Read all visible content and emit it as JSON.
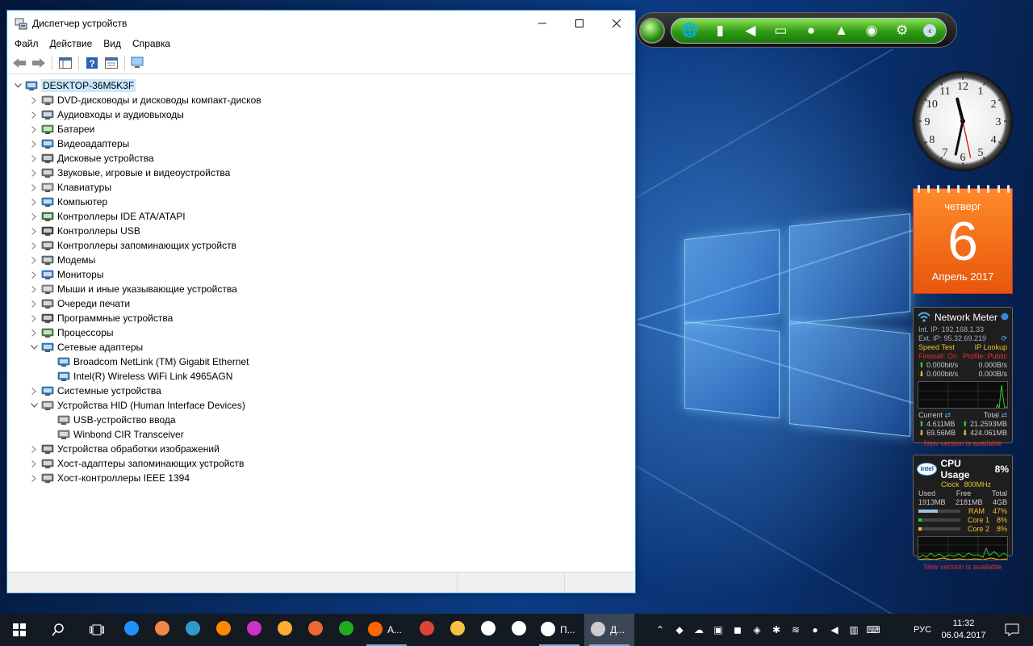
{
  "window": {
    "title": "Диспетчер устройств",
    "menu": [
      "Файл",
      "Действие",
      "Вид",
      "Справка"
    ],
    "tree": {
      "root": "DESKTOP-36M5K3F",
      "categories": [
        {
          "label": "DVD-дисководы и дисководы компакт-дисков",
          "icon": "dvd-drive-icon",
          "expanded": false
        },
        {
          "label": "Аудиовходы и аудиовыходы",
          "icon": "audio-io-icon",
          "expanded": false
        },
        {
          "label": "Батареи",
          "icon": "battery-icon",
          "expanded": false
        },
        {
          "label": "Видеоадаптеры",
          "icon": "display-adapter-icon",
          "expanded": false
        },
        {
          "label": "Дисковые устройства",
          "icon": "disk-drive-icon",
          "expanded": false
        },
        {
          "label": "Звуковые, игровые и видеоустройства",
          "icon": "sound-device-icon",
          "expanded": false
        },
        {
          "label": "Клавиатуры",
          "icon": "keyboard-icon",
          "expanded": false
        },
        {
          "label": "Компьютер",
          "icon": "computer-icon",
          "expanded": false
        },
        {
          "label": "Контроллеры IDE ATA/ATAPI",
          "icon": "ide-controller-icon",
          "expanded": false
        },
        {
          "label": "Контроллеры USB",
          "icon": "usb-icon",
          "expanded": false
        },
        {
          "label": "Контроллеры запоминающих устройств",
          "icon": "storage-controller-icon",
          "expanded": false
        },
        {
          "label": "Модемы",
          "icon": "modem-icon",
          "expanded": false
        },
        {
          "label": "Мониторы",
          "icon": "monitor-icon",
          "expanded": false
        },
        {
          "label": "Мыши и иные указывающие устройства",
          "icon": "mouse-icon",
          "expanded": false
        },
        {
          "label": "Очереди печати",
          "icon": "print-queue-icon",
          "expanded": false
        },
        {
          "label": "Программные устройства",
          "icon": "software-device-icon",
          "expanded": false
        },
        {
          "label": "Процессоры",
          "icon": "processor-icon",
          "expanded": false
        },
        {
          "label": "Сетевые адаптеры",
          "icon": "network-adapter-icon",
          "expanded": true,
          "children": [
            "Broadcom NetLink (TM) Gigabit Ethernet",
            "Intel(R) Wireless WiFi Link 4965AGN"
          ]
        },
        {
          "label": "Системные устройства",
          "icon": "system-device-icon",
          "expanded": false
        },
        {
          "label": "Устройства HID (Human Interface Devices)",
          "icon": "hid-icon",
          "expanded": true,
          "children": [
            "USB-устройство ввода",
            "Winbond CIR Transceiver"
          ]
        },
        {
          "label": "Устройства обработки изображений",
          "icon": "imaging-device-icon",
          "expanded": false
        },
        {
          "label": "Хост-адаптеры запоминающих устройств",
          "icon": "storage-host-icon",
          "expanded": false
        },
        {
          "label": "Хост-контроллеры IEEE 1394",
          "icon": "ieee1394-icon",
          "expanded": false
        }
      ]
    }
  },
  "gadgets": {
    "toolbar_icons": [
      "globe-icon",
      "battery-icon",
      "volume-icon",
      "radio-icon",
      "bulb-icon",
      "lock-icon",
      "globe-update-icon",
      "gear-icon",
      "collapse-arrow-icon"
    ],
    "clock": {
      "hour": 11,
      "minute": 32,
      "second": 28
    },
    "calendar": {
      "weekday": "четверг",
      "day": "6",
      "month": "Апрель 2017"
    },
    "network_meter": {
      "title": "Network Meter",
      "int_ip": "Int. IP: 192.168.1.33",
      "ext_ip": "Ext. IP: 95.32.69.219",
      "speed_test": "Speed Test",
      "ip_lookup": "IP Lookup",
      "firewall": "Firewall: On",
      "profile": "Profile: Public",
      "up_bits": "0.000bit/s",
      "up_bytes": "0.000B/s",
      "down_bits": "0.000bit/s",
      "down_bytes": "0.000B/s",
      "current_label": "Current",
      "total_label": "Total",
      "current_up": "4.611MB",
      "total_up": "21.2593MB",
      "current_down": "69.56MB",
      "total_down": "424.061MB",
      "notice": "New version is available"
    },
    "cpu_meter": {
      "brand": "intel",
      "title": "CPU Usage",
      "percent": "8%",
      "clock_label": "Clock",
      "clock_value": "800MHz",
      "used_label": "Used",
      "free_label": "Free",
      "total_label": "Total",
      "used": "1913MB",
      "free": "2181MB",
      "total": "4GB",
      "ram_label": "RAM",
      "ram_percent": "47%",
      "ram_level": 0.47,
      "core1_label": "Core 1",
      "core1_percent": "8%",
      "core1_level": 0.08,
      "core2_label": "Core 2",
      "core2_percent": "8%",
      "core2_level": 0.08,
      "notice": "New version is available"
    }
  },
  "taskbar": {
    "apps": [
      {
        "name": "edge-icon"
      },
      {
        "name": "paint-app-icon"
      },
      {
        "name": "movie-maker-icon"
      },
      {
        "name": "media-player-icon"
      },
      {
        "name": "picasa-icon"
      },
      {
        "name": "pen-app-icon"
      },
      {
        "name": "photo-app-icon"
      },
      {
        "name": "xbox-icon"
      },
      {
        "name": "firefox-icon",
        "label": "А..."
      },
      {
        "name": "chrome-icon"
      },
      {
        "name": "file-explorer-icon"
      },
      {
        "name": "store-icon"
      },
      {
        "name": "mail-icon"
      },
      {
        "name": "settings-icon",
        "label": "П..."
      },
      {
        "name": "device-manager-icon",
        "label": "Д..."
      }
    ],
    "language": "РУС",
    "time": "11:32",
    "date": "06.04.2017"
  }
}
